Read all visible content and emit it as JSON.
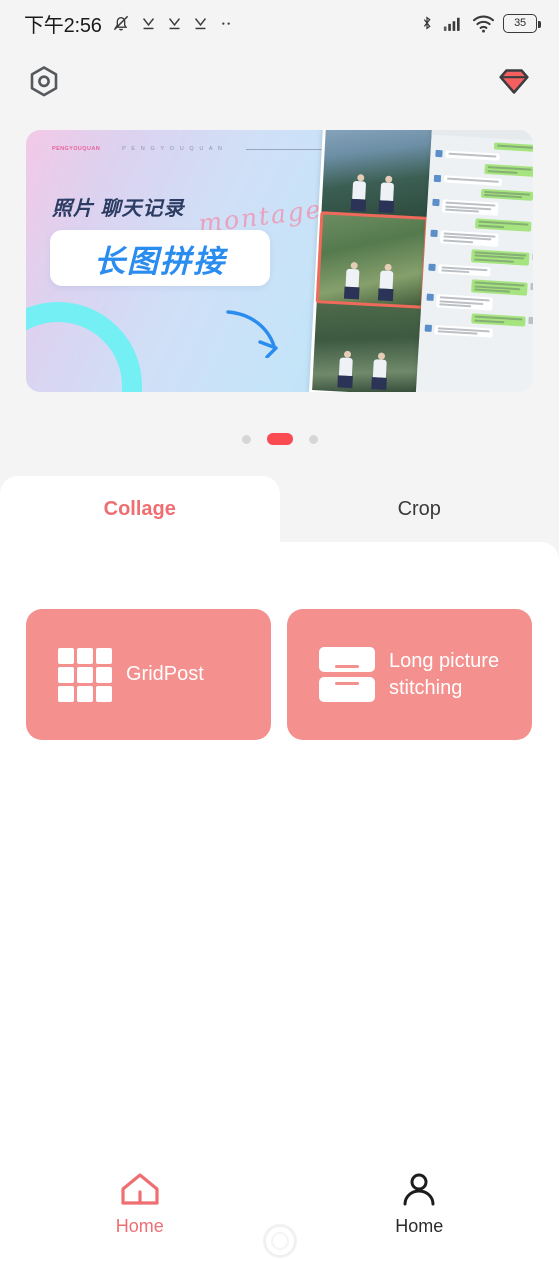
{
  "status_bar": {
    "time": "下午2:56",
    "left_icons": [
      "bell-muted-icon",
      "download-check-icon",
      "download-check-icon",
      "download-check-icon",
      "more-dots-icon"
    ],
    "right_icons": [
      "bluetooth-icon",
      "cellular-signal-icon",
      "wifi-icon"
    ],
    "battery_level": "35"
  },
  "app_bar": {
    "left_icon": "hexagon-settings-icon",
    "right_icon": "diamond-vip-icon",
    "accent": "#f4908e"
  },
  "banner": {
    "tiny_brand": "PENGYOUQUAN",
    "tiny_spaced": "P E N G Y O U Q U A N",
    "subtitle": "照片 聊天记录",
    "script": "montage",
    "headline": "长图拼接",
    "arrow_icon": "curved-arrow-icon",
    "photo_collage_icon": "photo-collage-thumbnail",
    "chat_screenshot_icon": "chat-screenshot-thumbnail"
  },
  "carousel": {
    "dots": [
      "inactive",
      "active",
      "inactive"
    ],
    "active_index": 1,
    "active_color": "#fa4b52"
  },
  "tabs": [
    {
      "label": "Collage",
      "active": true
    },
    {
      "label": "Crop",
      "active": false
    }
  ],
  "feature_cards": [
    {
      "label": "GridPost",
      "icon": "grid-3x3-icon",
      "color": "#f4908e"
    },
    {
      "label": "Long picture stitching",
      "icon": "stacked-bars-icon",
      "color": "#f4908e"
    }
  ],
  "bottom_nav": [
    {
      "label": "Home",
      "icon": "house-icon",
      "active": true
    },
    {
      "label": "Home",
      "icon": "person-icon",
      "active": false
    }
  ],
  "system_nav": {
    "home_indicator": "home-gesture-circle"
  }
}
